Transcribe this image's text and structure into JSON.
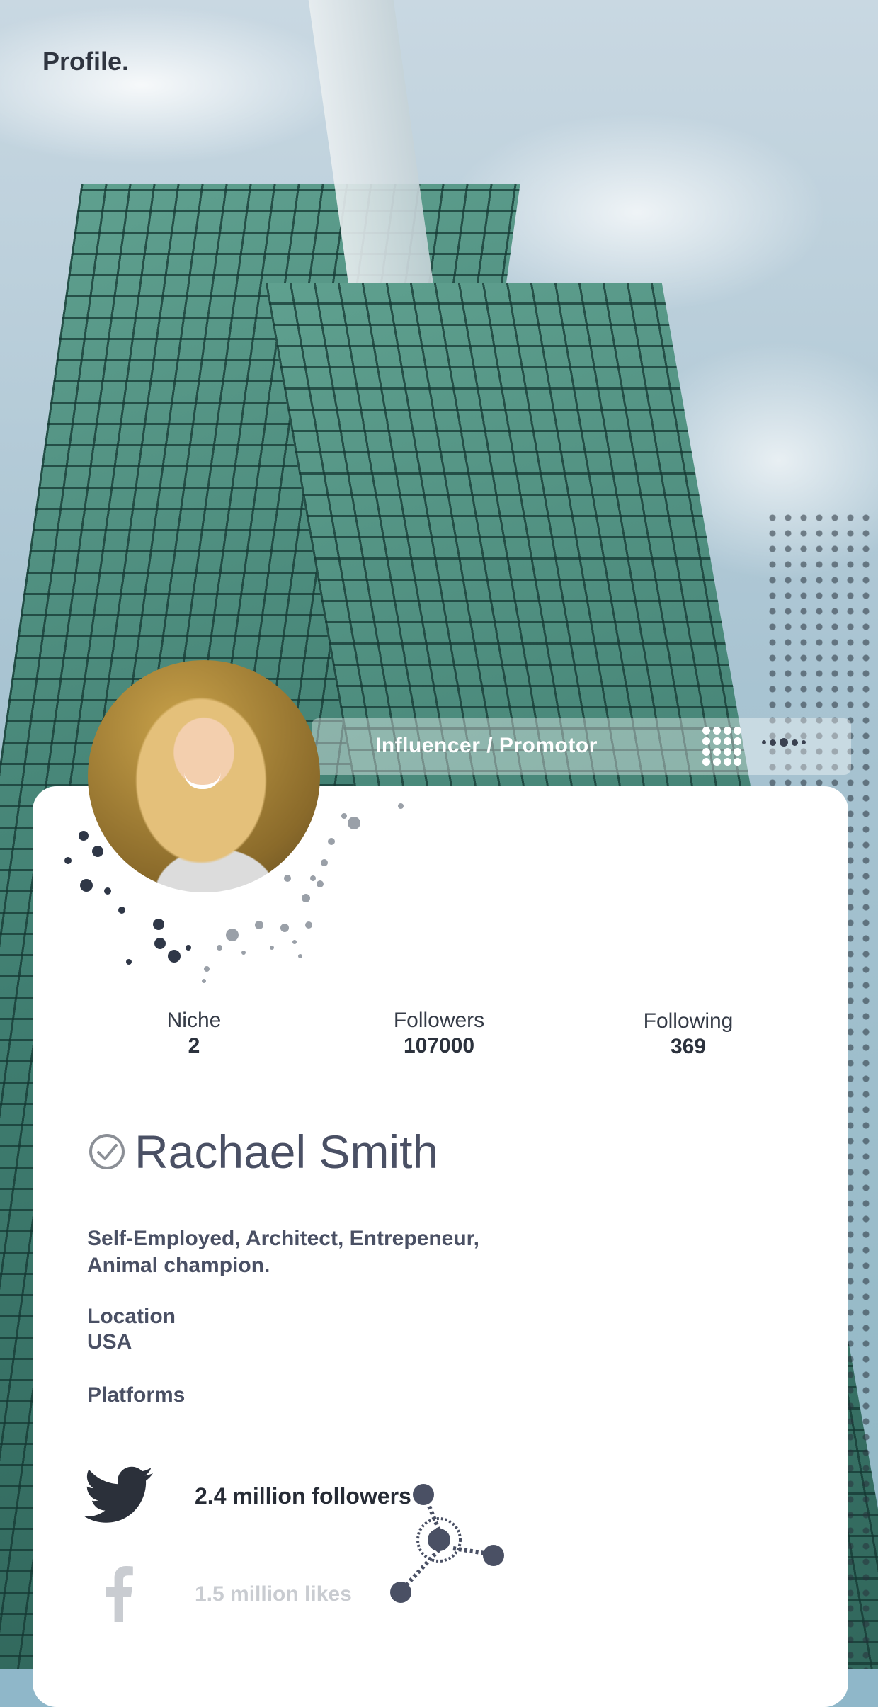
{
  "header": {
    "title": "Profile."
  },
  "role_bar": {
    "label": "Influencer / Promotor",
    "grid_icon": "grid-menu-icon",
    "more_icon": "more-dots-icon"
  },
  "stats": [
    {
      "label": "Niche",
      "value": "2"
    },
    {
      "label": "Followers",
      "value": "107000"
    },
    {
      "label": "Following",
      "value": "369"
    }
  ],
  "profile": {
    "name": "Rachael Smith",
    "verified_icon": "check-circle-icon",
    "bio_line1": "Self-Employed, Architect, Entrepeneur,",
    "bio_line2": "Animal champion.",
    "location_label": "Location",
    "location_value": "USA",
    "platforms_label": "Platforms"
  },
  "platforms": [
    {
      "icon": "twitter-icon",
      "text": "2.4 million followers"
    },
    {
      "icon": "facebook-icon",
      "text": "1.5 million likes"
    }
  ],
  "colors": {
    "text_dark": "#2f3540",
    "text_slate": "#4a5064",
    "muted": "#c9ccd1",
    "accent_node": "#4a5064"
  }
}
